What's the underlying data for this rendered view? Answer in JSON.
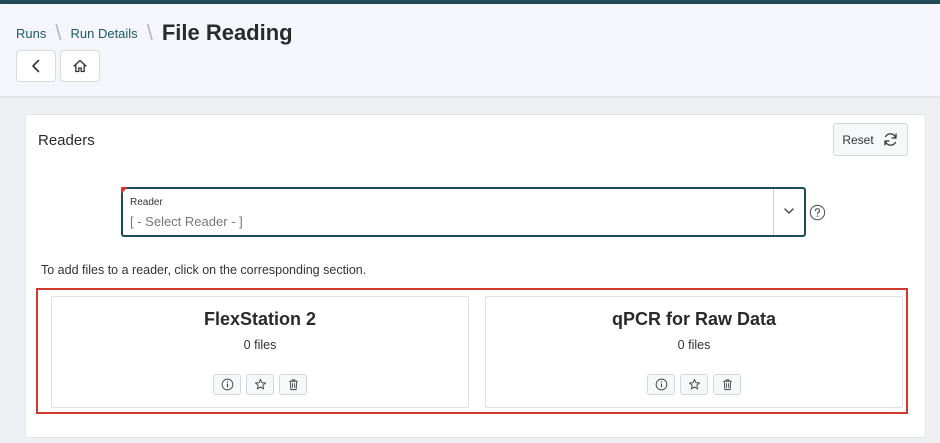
{
  "breadcrumb": {
    "items": [
      {
        "label": "Runs"
      },
      {
        "label": "Run Details"
      }
    ],
    "current": "File Reading"
  },
  "header_buttons": {
    "back_icon": "chevron-left-icon",
    "home_icon": "home-icon"
  },
  "readers_panel": {
    "title": "Readers",
    "reset_label": "Reset",
    "reset_icon": "refresh-icon",
    "select": {
      "label": "Reader",
      "value": "[ - Select Reader - ]"
    },
    "instructions": "To add files to a reader, click on the corresponding section.",
    "readers": [
      {
        "name": "FlexStation 2",
        "file_count": "0 files"
      },
      {
        "name": "qPCR for Raw Data",
        "file_count": "0 files"
      }
    ]
  },
  "colors": {
    "top_bar": "#1f4a56",
    "link": "#1d5a6b",
    "highlight_border": "#d0392b"
  }
}
